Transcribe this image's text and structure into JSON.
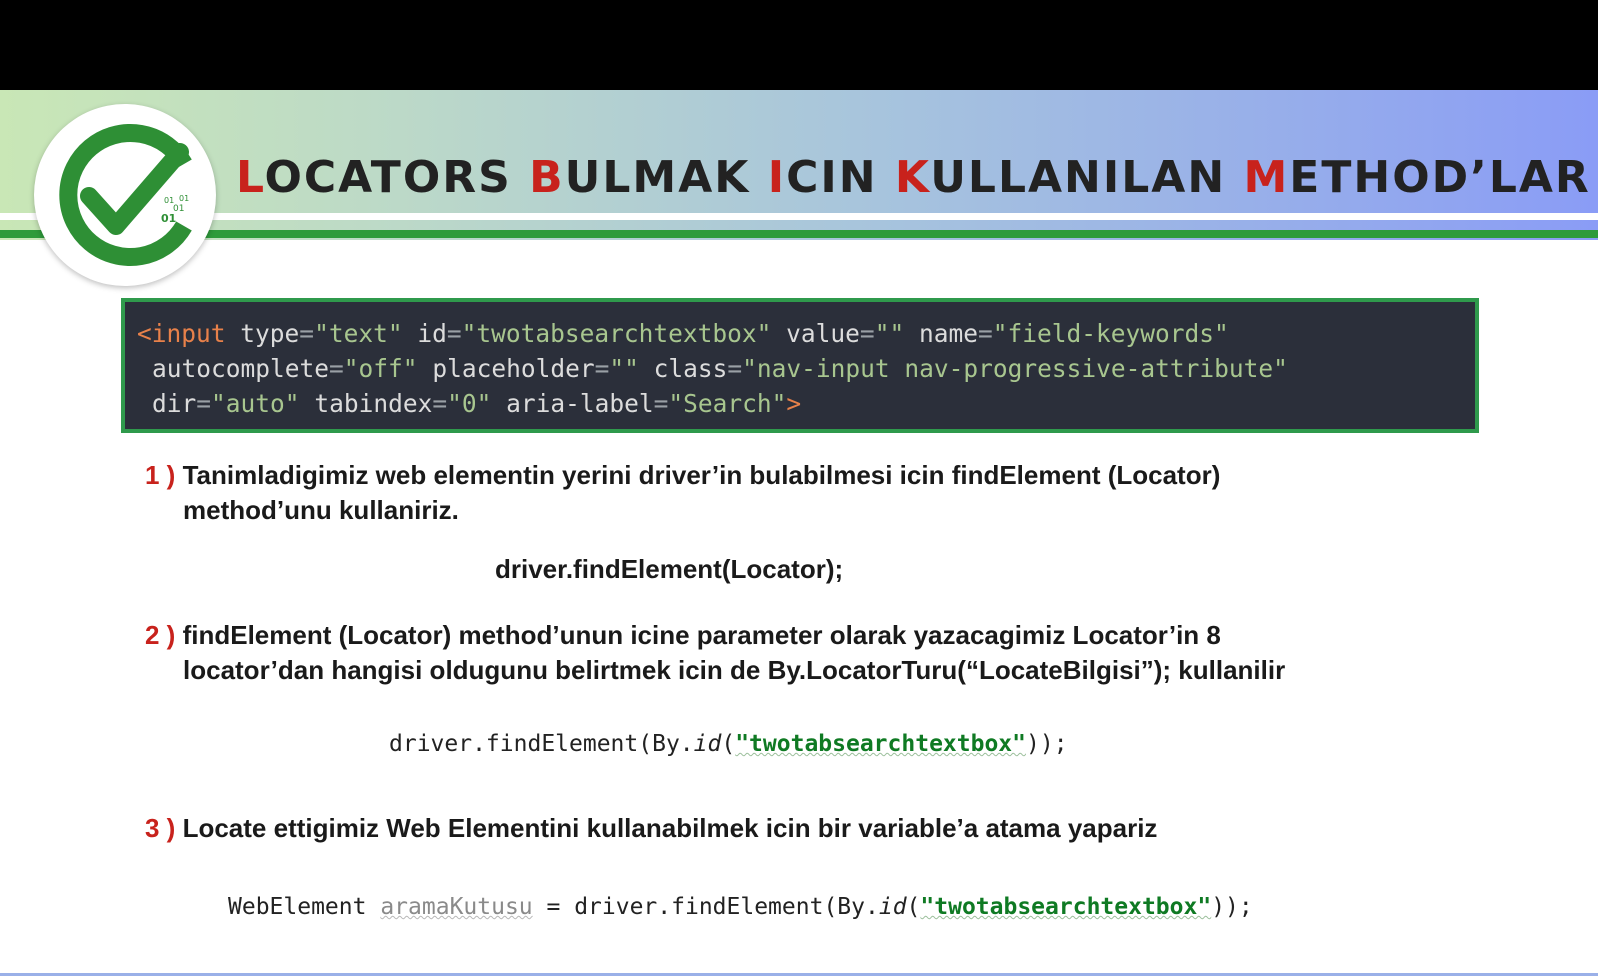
{
  "header": {
    "title_parts": [
      {
        "cap": "L",
        "rest": "OCATORS "
      },
      {
        "cap": "B",
        "rest": "ULMAK "
      },
      {
        "cap": "I",
        "rest": "CIN "
      },
      {
        "cap": "K",
        "rest": "ULLANILAN "
      },
      {
        "cap": "M",
        "rest": "ETHOD’LAR"
      }
    ]
  },
  "logo": {
    "icon": "checkmark-circle-icon",
    "binary_text": [
      "01",
      "01",
      "01",
      "01"
    ]
  },
  "html_snippet": {
    "line1": {
      "open": "<input",
      "a1": "type",
      "v1": "\"text\"",
      "a2": "id",
      "v2": "\"twotabsearchtextbox\"",
      "a3": "value",
      "v3": "\"\"",
      "a4": "name",
      "v4": "\"field-keywords\""
    },
    "line2": {
      "a1": "autocomplete",
      "v1": "\"off\"",
      "a2": "placeholder",
      "v2": "\"\"",
      "a3": "class",
      "v3": "\"nav-input nav-progressive-attribute\""
    },
    "line3": {
      "a1": "dir",
      "v1": "\"auto\"",
      "a2": "tabindex",
      "v2": "\"0\"",
      "a3": "aria-label",
      "v3": "\"Search\"",
      "close": ">"
    },
    "eq": "="
  },
  "items": [
    {
      "num": "1 )",
      "line1": "Tanimladigimiz web elementin yerini driver’in bulabilmesi icin findElement (Locator)",
      "line2": "method’unu kullaniriz.",
      "code": "driver.findElement(Locator);"
    },
    {
      "num": "2 )",
      "line1": "findElement (Locator) method’unun icine parameter olarak yazacagimiz Locator’in 8",
      "line2": "locator’dan hangisi oldugunu belirtmek icin de By.LocatorTuru(“LocateBilgisi”); kullanilir",
      "code_pre": "driver.findElement(By.",
      "code_it": "id",
      "code_mid": "(",
      "code_str": "\"twotabsearchtextbox\"",
      "code_post": "));"
    },
    {
      "num": "3 )",
      "line1": "Locate ettigimiz Web Elementini kullanabilmek icin bir variable’a atama yapariz",
      "code_type": "WebElement ",
      "code_var": "aramaKutusu",
      "code_pre": " = driver.findElement(By.",
      "code_it": "id",
      "code_mid": "(",
      "code_str": "\"twotabsearchtextbox\"",
      "code_post": "));"
    }
  ],
  "colors": {
    "accent_red": "#c8221c",
    "green": "#2e9b3b",
    "code_bg": "#2b2f3a"
  }
}
